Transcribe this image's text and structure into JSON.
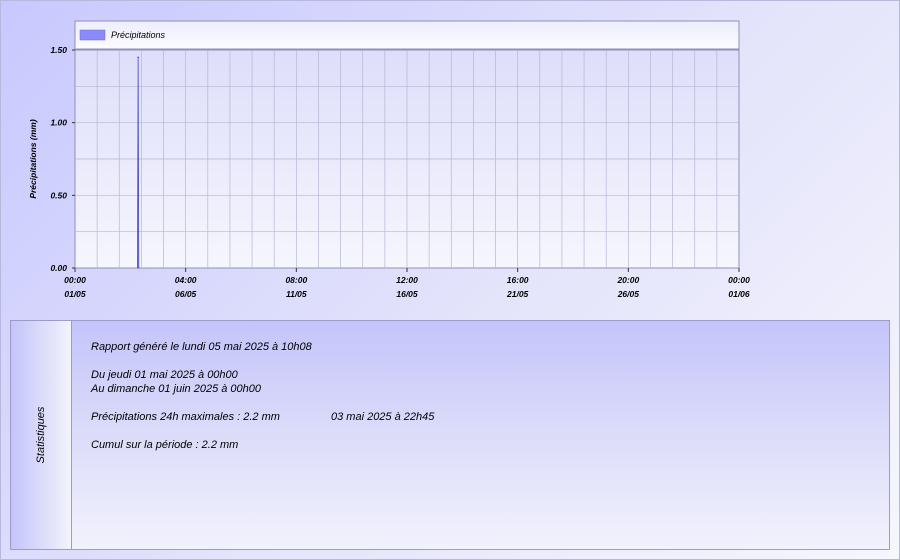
{
  "chart_data": {
    "type": "area",
    "ylabel": "Précipitations (mm)",
    "y_ticks": [
      "0.00",
      "0.50",
      "1.00",
      "1.50"
    ],
    "ylim": [
      0,
      1.5
    ],
    "x_ticks": [
      {
        "time": "00:00",
        "date": "01/05"
      },
      {
        "time": "04:00",
        "date": "06/05"
      },
      {
        "time": "08:00",
        "date": "11/05"
      },
      {
        "time": "12:00",
        "date": "16/05"
      },
      {
        "time": "16:00",
        "date": "21/05"
      },
      {
        "time": "20:00",
        "date": "26/05"
      },
      {
        "time": "00:00",
        "date": "01/06"
      }
    ],
    "x_range": [
      "2025-05-01 00:00",
      "2025-06-01 00:00"
    ],
    "grid": true,
    "legend_position": "top",
    "series": [
      {
        "name": "Précipitations",
        "color": "#8a8af8",
        "stroke": "#4848c8",
        "points": [
          {
            "x": "2025-05-03 22:00",
            "y": 0
          },
          {
            "x": "2025-05-03 22:45",
            "y": 1.45
          },
          {
            "x": "2025-05-03 23:30",
            "y": 0
          }
        ]
      }
    ]
  },
  "stats": {
    "title": "Statistiques",
    "report_line": "Rapport généré le lundi 05 mai 2025 à 10h08",
    "from_line": "Du jeudi 01 mai 2025 à 00h00",
    "to_line": "Au dimanche 01 juin 2025 à 00h00",
    "max_line": "Précipitations 24h maximales : 2.2 mm",
    "max_date": "03 mai 2025 à 22h45",
    "total_line": "Cumul sur la période : 2.2 mm"
  }
}
